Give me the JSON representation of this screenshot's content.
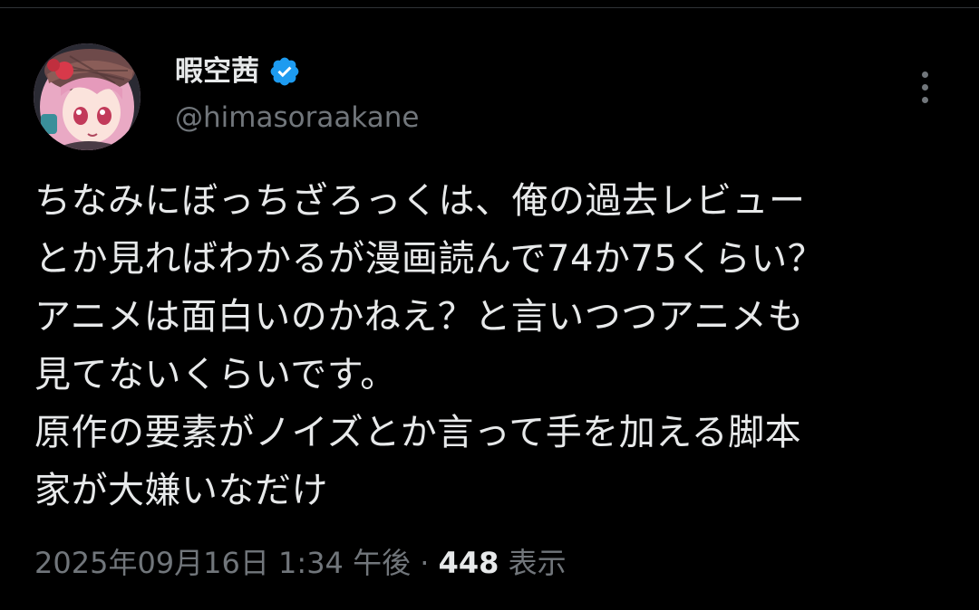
{
  "author": {
    "display_name": "暇空茜",
    "handle": "@himasoraakane",
    "verified_color": "#1d9bf0"
  },
  "tweet": {
    "lines": [
      "ちなみにぼっちざろっくは、俺の過去レビュー",
      "とか見ればわかるが漫画読んで74か75くらい？",
      "アニメは面白いのかねえ？と言いつつアニメも",
      "見てないくらいです。",
      "原作の要素がノイズとか言って手を加える脚本",
      "家が大嫌いなだけ"
    ]
  },
  "meta": {
    "timestamp": "2025年09月16日 1:34 午後",
    "separator": "·",
    "views_count": "448",
    "views_label": "表示"
  },
  "icons": {
    "avatar": "avatar-image",
    "verified": "verified-badge-icon",
    "more": "more-options-icon"
  },
  "colors": {
    "background": "#000000",
    "text_primary": "#e7e9ea",
    "text_secondary": "#71767b",
    "accent": "#1d9bf0"
  }
}
